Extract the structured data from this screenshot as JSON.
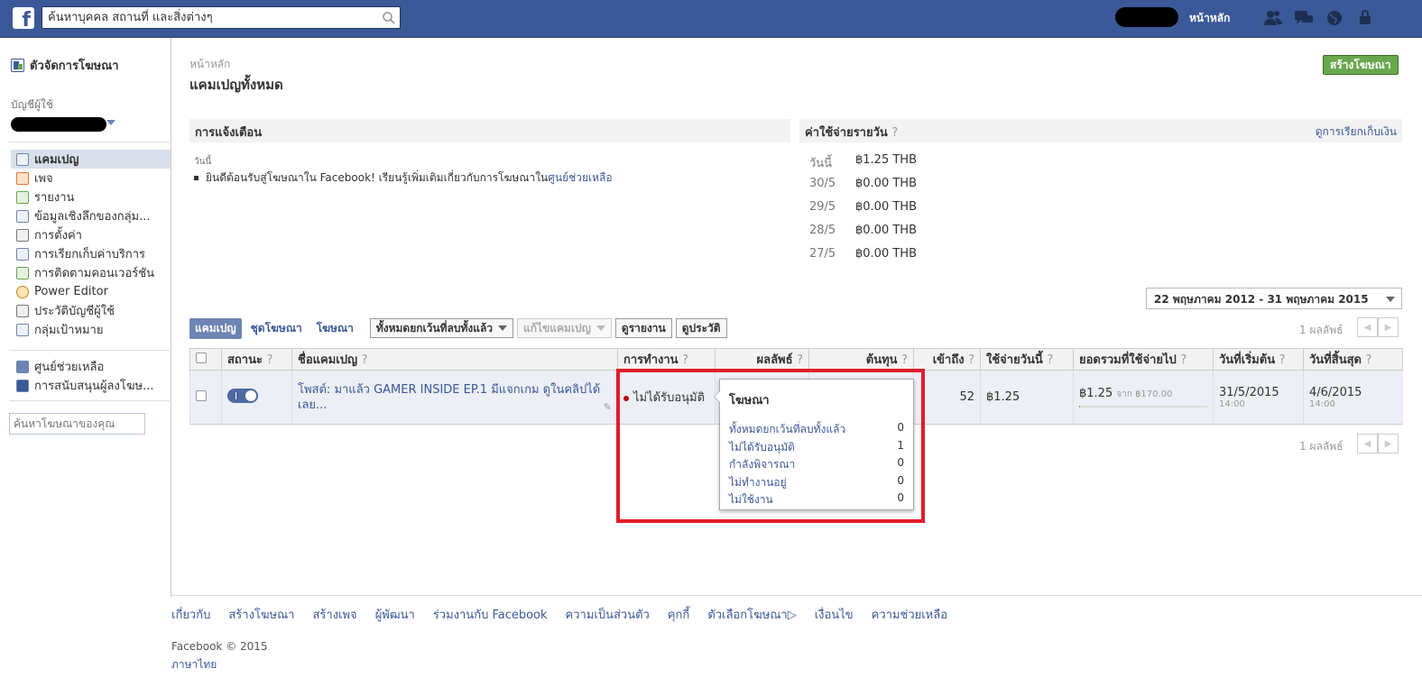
{
  "topbar": {
    "search_placeholder": "ค้นหาบุคคล สถานที่ และสิ่งต่างๆ",
    "home_label": "หน้าหลัก",
    "icons": [
      "friend-requests-icon",
      "messages-icon",
      "notifications-globe-icon",
      "privacy-shortcuts-icon"
    ],
    "bg_color": "#3b5998"
  },
  "sidebar": {
    "title": "ตัวจัดการโฆษณา",
    "account_label": "บัญชีผู้ใช้",
    "items": [
      {
        "label": "แคมเปญ",
        "icon": "campaign-icon",
        "active": true
      },
      {
        "label": "เพจ",
        "icon": "pages-icon"
      },
      {
        "label": "รายงาน",
        "icon": "reports-icon"
      },
      {
        "label": "ข้อมูลเชิงลึกของกลุ่ม...",
        "icon": "audience-insights-icon"
      },
      {
        "label": "การตั้งค่า",
        "icon": "settings-icon"
      },
      {
        "label": "การเรียกเก็บค่าบริการ",
        "icon": "billing-icon"
      },
      {
        "label": "การติดตามคอนเวอร์ชัน",
        "icon": "conversion-tracking-icon"
      },
      {
        "label": "Power Editor",
        "icon": "power-editor-icon"
      },
      {
        "label": "ประวัติบัญชีผู้ใช้",
        "icon": "account-history-icon"
      },
      {
        "label": "กลุ่มเป้าหมาย",
        "icon": "audiences-icon"
      }
    ],
    "help_items": [
      {
        "label": "ศูนย์ช่วยเหลือ",
        "icon": "help-center-icon"
      },
      {
        "label": "การสนับสนุนผู้ลงโฆษ...",
        "icon": "advertiser-support-icon"
      }
    ],
    "search_placeholder": "ค้นหาโฆษณาของคุณ"
  },
  "main": {
    "breadcrumb": "หน้าหลัก",
    "title": "แคมเปญทั้งหมด",
    "create_ad_label": "สร้างโฆษณา",
    "notifications": {
      "header": "การแจ้งเตือน",
      "date": "วันนี้",
      "text_prefix": "ยินดีต้อนรับสู่โฆษณาใน Facebook! เรียนรู้เพิ่มเติมเกี่ยวกับการโฆษณาใน",
      "link": "ศูนย์ช่วยเหลือ"
    },
    "daily_spend": {
      "header": "ค่าใช้จ่ายรายวัน",
      "q": "?",
      "billing_link": "ดูการเรียกเก็บเงิน",
      "rows": [
        {
          "date": "วันนี้",
          "value": "฿1.25 THB"
        },
        {
          "date": "30/5",
          "value": "฿0.00 THB"
        },
        {
          "date": "29/5",
          "value": "฿0.00 THB"
        },
        {
          "date": "28/5",
          "value": "฿0.00 THB"
        },
        {
          "date": "27/5",
          "value": "฿0.00 THB"
        }
      ]
    },
    "date_range": "22 พฤษภาคม 2012 - 31 พฤษภาคม 2015",
    "tabs": [
      "แคมเปญ",
      "ชุดโฆษณา",
      "โฆษณา"
    ],
    "filter_label": "ทั้งหมดยกเว้นที่ลบทั้งแล้ว",
    "edit_campaign_label": "แก้ไขแคมเปญ",
    "view_report_label": "ดูรายงาน",
    "view_history_label": "ดูประวัติ",
    "results_count": "1 ผลลัพธ์",
    "table": {
      "columns": [
        "สถานะ",
        "ชื่อแคมเปญ",
        "การทำงาน",
        "ผลลัพธ์",
        "ต้นทุน",
        "เข้าถึง",
        "ใช้จ่ายวันนี้",
        "ยอดรวมที่ใช้จ่ายไป",
        "วันที่เริ่มต้น",
        "วันที่สิ้นสุด"
      ],
      "q": "?",
      "row": {
        "campaign_name": "โพสต์: มาแล้ว GAMER INSIDE EP.1 มีแจกเกม ดูในคลิปได้เลย...",
        "delivery": "ไม่ได้รับอนุมัติ",
        "reach": "52",
        "spent_today": "฿1.25",
        "total_spent": "฿1.25",
        "total_budget": "จาก ฿170.00",
        "budget_used_fraction": 0.007,
        "start_date": "31/5/2015",
        "start_time": "14:00",
        "end_date": "4/6/2015",
        "end_time": "14:00"
      }
    },
    "popover": {
      "title": "โฆษณา",
      "rows": [
        {
          "label": "ทั้งหมดยกเว้นที่ลบทั้งแล้ว",
          "count": "0"
        },
        {
          "label": "ไม่ได้รับอนุมัติ",
          "count": "1"
        },
        {
          "label": "กำลังพิจารณา",
          "count": "0"
        },
        {
          "label": "ไม่ทำงานอยู่",
          "count": "0"
        },
        {
          "label": "ไม่ใช้งาน",
          "count": "0"
        }
      ]
    },
    "highlight_color": "#e21c2a"
  },
  "footer": {
    "links": [
      "เกี่ยวกับ",
      "สร้างโฆษณา",
      "สร้างเพจ",
      "ผู้พัฒนา",
      "ร่วมงานกับ Facebook",
      "ความเป็นส่วนตัว",
      "คุกกี้",
      "ตัวเลือกโฆษณา▷",
      "เงื่อนไข",
      "ความช่วยเหลือ"
    ],
    "copyright": "Facebook © 2015",
    "language": "ภาษาไทย"
  }
}
